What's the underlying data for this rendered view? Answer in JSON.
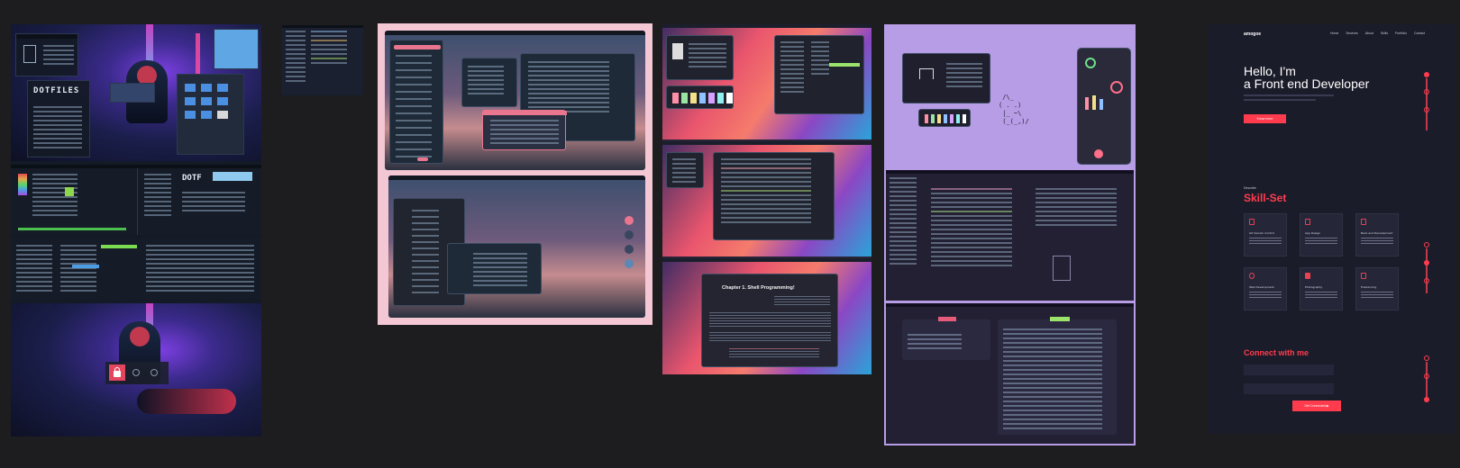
{
  "panels": [
    {
      "name": "dotfiles-cyberpunk-collage"
    },
    {
      "name": "editor-thumbnail"
    },
    {
      "name": "pink-rice-collage"
    },
    {
      "name": "wave-wallpaper-rice"
    },
    {
      "name": "lavender-rice"
    },
    {
      "name": "portfolio-site"
    }
  ],
  "dotfiles": {
    "logo": "DOTFILES",
    "logo_small": "DOTF"
  },
  "shell_book": {
    "heading": "Chapter 1. Shell Programming!"
  },
  "portfolio": {
    "brand": "amogoe",
    "nav": [
      "Home",
      "Services",
      "About",
      "Skills",
      "Portfolio",
      "Contact"
    ],
    "hero_line1": "Hello, I'm",
    "hero_line2": "a Front end Developer",
    "hero_button": "Know more",
    "skills_kicker": "Describe",
    "skills_title": "Skill-Set",
    "skills": [
      {
        "title": "Git Version Control",
        "icon": "git-icon"
      },
      {
        "title": "App Design",
        "icon": "mobile-icon"
      },
      {
        "title": "Back-end Development",
        "icon": "server-icon"
      },
      {
        "title": "Web Development",
        "icon": "globe-icon"
      },
      {
        "title": "Photography",
        "icon": "camera-icon"
      },
      {
        "title": "Freelancing",
        "icon": "briefcase-icon"
      }
    ],
    "connect_title": "Connect with me",
    "connect_button": "Get Connected ▶",
    "accent": "#ff3c4d"
  },
  "colors": {
    "background": "#1d1d1f",
    "pink_frame": "#f4c7d4",
    "lavender_frame": "#b79ce6",
    "portfolio_bg": "#1b1c2a"
  }
}
